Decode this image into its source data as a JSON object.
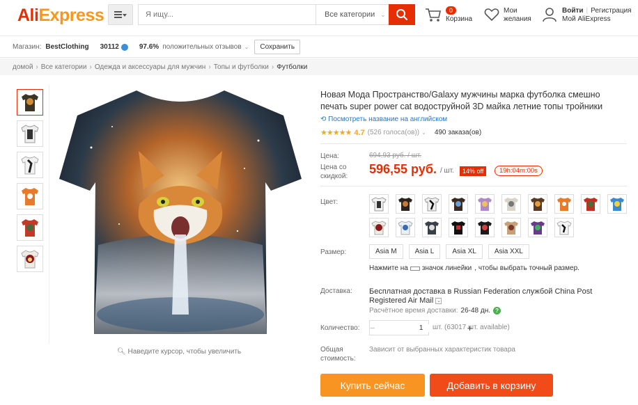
{
  "header": {
    "logo_part1": "Ali",
    "logo_part2": "Express",
    "search_placeholder": "Я ищу...",
    "search_category": "Все категории",
    "cart_count": "0",
    "cart_label": "Корзина",
    "wishlist_label_1": "Мои",
    "wishlist_label_2": "желания",
    "login": "Войти",
    "register": "Регистрация",
    "my_account": "Мой AliExpress"
  },
  "store": {
    "label": "Магазин:",
    "name": "BestClothing",
    "score": "30112",
    "positive_pct": "97.6%",
    "positive_label": "положительных отзывов",
    "save_button": "Сохранить"
  },
  "breadcrumb": [
    "домой",
    "Все категории",
    "Одежда и аксессуары для мужчин",
    "Топы и футболки",
    "Футболки"
  ],
  "gallery": {
    "zoom_hint": "Наведите курсор, чтобы увеличить"
  },
  "product": {
    "title": "Новая Мода Пространство/Galaxy мужчины марка футболка смешно печать super power cat водоструйной 3D майка летние топы тройники",
    "translate_link": "Посмотреть название на английском",
    "rating_score": "4.7",
    "votes": "(526 голоса(ов))",
    "orders": "490 заказа(ов)",
    "rating_stars": 5
  },
  "pricing": {
    "price_label": "Цена:",
    "old_price": "694,93 руб. / шт.",
    "discount_label_1": "Цена со",
    "discount_label_2": "скидкой:",
    "price": "596,55 руб.",
    "per_unit": "/ шт.",
    "off_badge": "14% off",
    "timer": "19h:04m:00s"
  },
  "options": {
    "color_label": "Цвет:",
    "size_label": "Размер:",
    "sizes": [
      "Asia M",
      "Asia L",
      "Asia XL",
      "Asia XXL"
    ],
    "size_hint_before": "Нажмите на",
    "size_hint_icon": "значок линейки",
    "size_hint_after": ", чтобы выбрать точный размер."
  },
  "shipping": {
    "label": "Доставка:",
    "text": "Бесплатная доставка в Russian Federation службой China Post Registered Air Mail",
    "estimate_label": "Расчётное время доставки:",
    "days": "26-48 дн."
  },
  "quantity": {
    "label": "Количество:",
    "value": "1",
    "available": "шт. (63017 шт. available)"
  },
  "total": {
    "label_1": "Общая",
    "label_2": "стоимость:",
    "value": "Зависит от выбранных характеристик товара"
  },
  "actions": {
    "buy_now": "Купить сейчас",
    "add_to_cart": "Добавить в корзину"
  },
  "colors": {
    "brand_red": "#e62e04",
    "buy_orange": "#f89522",
    "cart_orange": "#f24b1a"
  }
}
